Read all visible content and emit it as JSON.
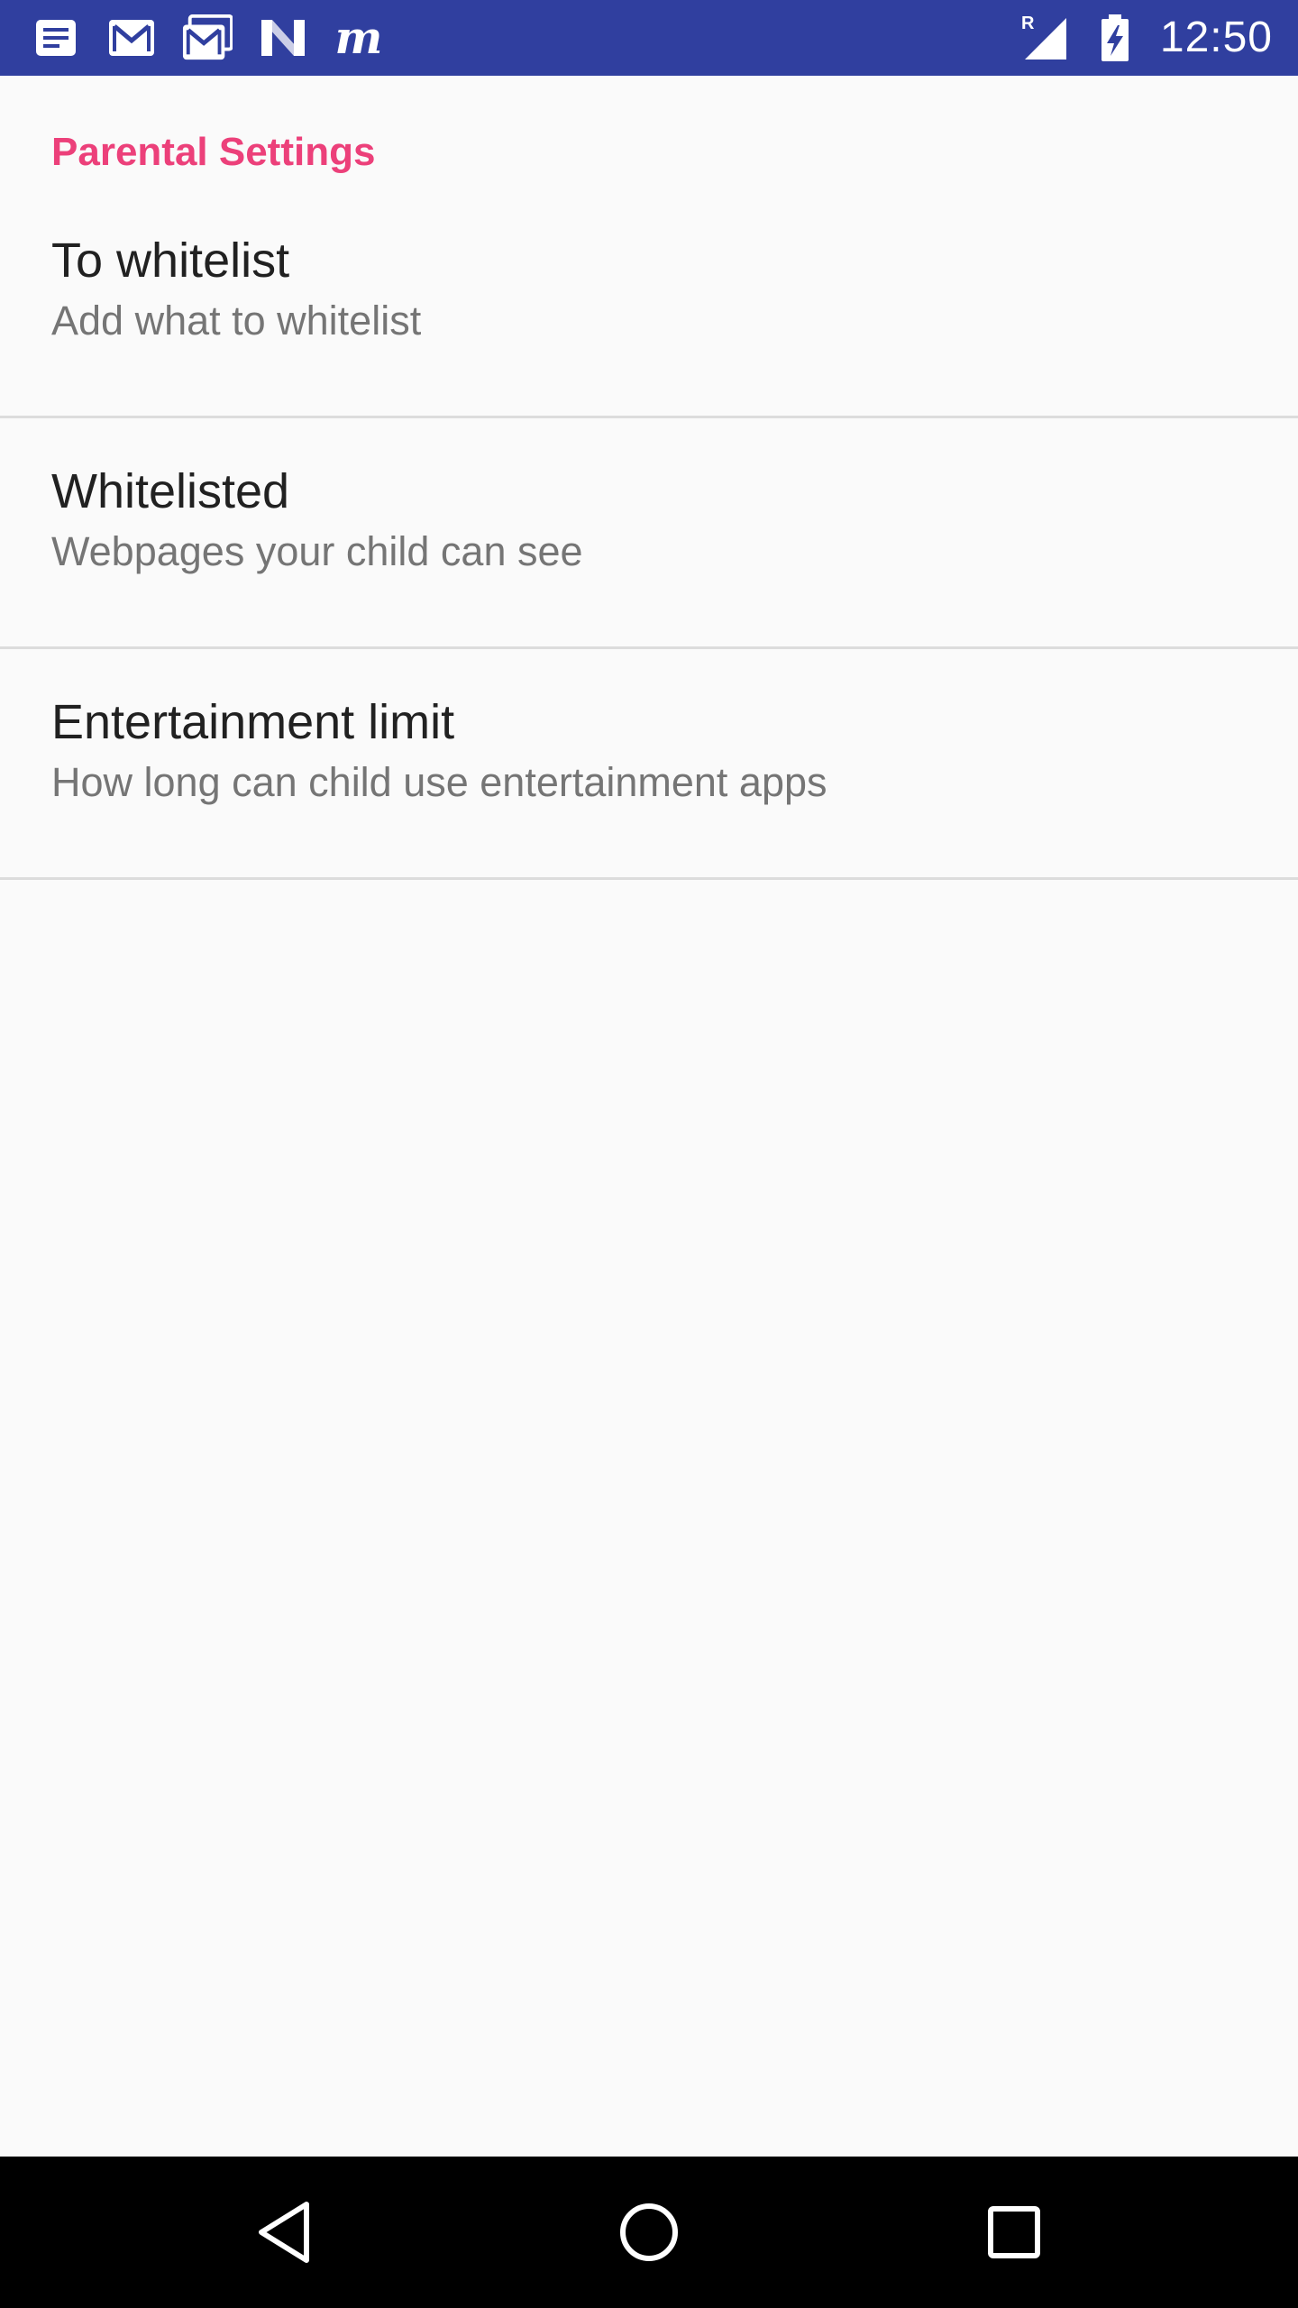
{
  "status_bar": {
    "background_color": "#303f9f",
    "notification_icons": [
      "news-icon",
      "gmail-icon",
      "gmail-stacked-icon",
      "n-logo-icon",
      "m-logo-icon"
    ],
    "m_logo_text": "m",
    "signal_label": "R",
    "time": "12:50"
  },
  "settings": {
    "section_title": "Parental Settings",
    "accent_color": "#ec407a",
    "items": [
      {
        "title": "To whitelist",
        "summary": "Add what to whitelist"
      },
      {
        "title": "Whitelisted",
        "summary": "Webpages your child can see"
      },
      {
        "title": "Entertainment limit",
        "summary": "How long can child use entertainment apps"
      }
    ]
  },
  "nav_bar": {
    "buttons": [
      "back-icon",
      "home-icon",
      "recents-icon"
    ]
  }
}
